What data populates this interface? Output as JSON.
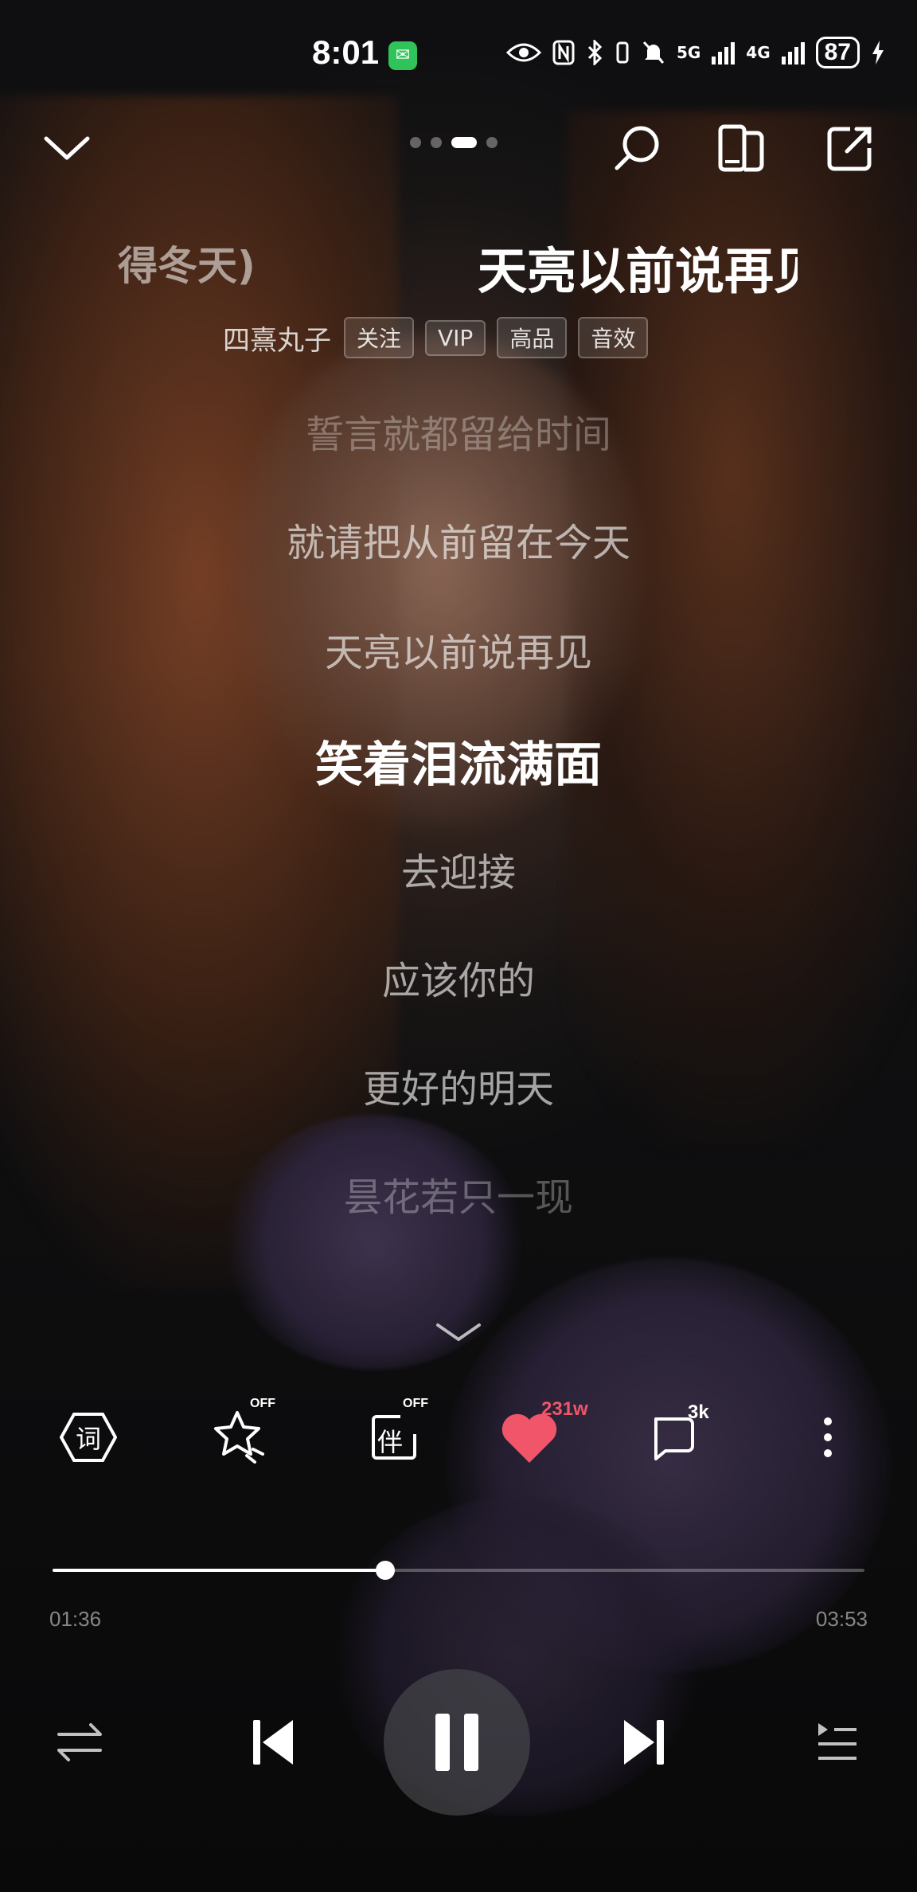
{
  "status_bar": {
    "time": "8:01",
    "network_1": "5G",
    "network_2": "4G",
    "battery": "87"
  },
  "header": {
    "pager_dots": 4,
    "pager_active_index": 2
  },
  "song": {
    "prev_title": "得冬天)",
    "title": "天亮以前说再见",
    "artist": "四熹丸子",
    "tags": [
      "关注",
      "VIP",
      "高品",
      "音效"
    ]
  },
  "lyrics": [
    {
      "text": "誓言就都留给时间",
      "state": "dim"
    },
    {
      "text": "就请把从前留在今天",
      "state": "normal"
    },
    {
      "text": "天亮以前说再见",
      "state": "normal"
    },
    {
      "text": "笑着泪流满面",
      "state": "active"
    },
    {
      "text": "去迎接",
      "state": "normal"
    },
    {
      "text": "应该你的",
      "state": "normal"
    },
    {
      "text": "更好的明天",
      "state": "normal"
    },
    {
      "text": "昙花若只一现",
      "state": "dim"
    }
  ],
  "actions": {
    "lyrics_icon_label": "词",
    "effect_off_label": "OFF",
    "accompany_icon_label": "伴",
    "accompany_off_label": "OFF",
    "like_count": "231w",
    "comment_count": "3k"
  },
  "playback": {
    "current_time": "01:36",
    "total_time": "03:53",
    "progress": 0.41
  },
  "colors": {
    "like": "#f0556a",
    "accent_white": "#ffffff"
  }
}
